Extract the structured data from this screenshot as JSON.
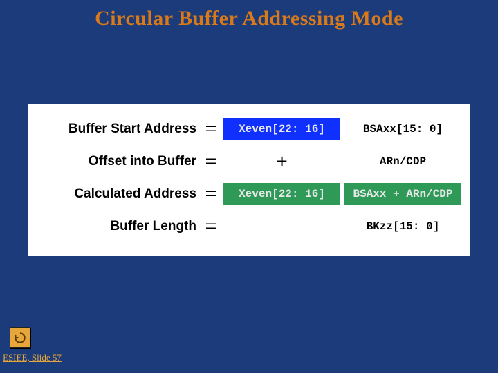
{
  "title": "Circular Buffer Addressing Mode",
  "rows": {
    "r1": {
      "label": "Buffer Start Address",
      "eq": "=",
      "left": "Xeven[22: 16]",
      "right": "BSAxx[15: 0]"
    },
    "r2": {
      "label": "Offset into Buffer",
      "eq": "=",
      "plus": "+",
      "right": "ARn/CDP"
    },
    "r3": {
      "label": "Calculated Address",
      "eq": "=",
      "left": "Xeven[22: 16]",
      "right": "BSAxx + ARn/CDP"
    },
    "r4": {
      "label": "Buffer Length",
      "eq": "=",
      "right": "BKzz[15: 0]"
    }
  },
  "footer": {
    "label": "ESIEE, Slide 57"
  }
}
